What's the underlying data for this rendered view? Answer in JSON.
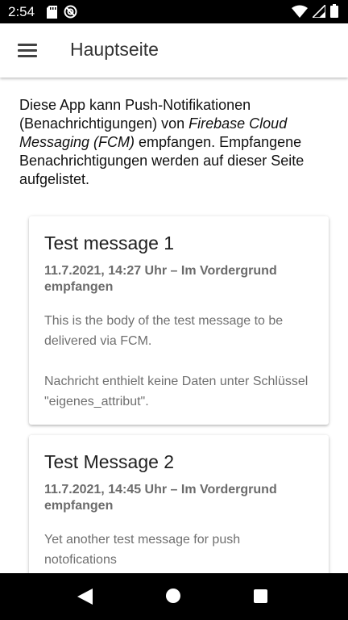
{
  "status_bar": {
    "time": "2:54",
    "icons": [
      "sd-card-icon",
      "do-not-disturb-icon",
      "wifi-icon",
      "signal-icon",
      "battery-icon"
    ]
  },
  "app_bar": {
    "title": "Hauptseite",
    "menu_icon": "menu-icon"
  },
  "intro": {
    "part1": "Diese App kann Push-Notifikationen (Benachrichtigungen) von ",
    "emphasis": "Firebase Cloud Messaging (FCM)",
    "part2": " empfangen. Empfangene Benachrichtigungen werden auf dieser Seite aufgelistet."
  },
  "messages": [
    {
      "title": "Test message 1",
      "meta": "11.7.2021, 14:27 Uhr – Im Vordergrund empfangen",
      "body": "This is the body of the test message to be delivered via FCM.",
      "note": "Nachricht enthielt keine Daten unter Schlüssel \"eigenes_attribut\"."
    },
    {
      "title": "Test Message 2",
      "meta": "11.7.2021, 14:45 Uhr – Im Vordergrund empfangen",
      "body": "Yet another test message for push notofications"
    }
  ],
  "nav_bar": {
    "icons": [
      "back-icon",
      "home-icon",
      "recents-icon"
    ]
  },
  "colors": {
    "status_bar_bg": "#000000",
    "app_bar_bg": "#ffffff",
    "title_text": "#333333",
    "secondary_text": "#6f6f6f"
  }
}
